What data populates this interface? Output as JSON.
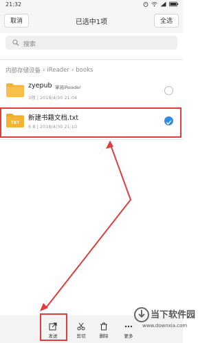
{
  "status_bar": {
    "time": "21:32"
  },
  "header": {
    "cancel_label": "取消",
    "title": "已选中1项",
    "select_all_label": "全选"
  },
  "search": {
    "placeholder": "搜索"
  },
  "breadcrumb": {
    "items": [
      "内部存储设备",
      "iReader",
      "books"
    ]
  },
  "files": [
    {
      "name": "zyepub",
      "source": "掌阅iReader",
      "meta": "3项 | 2018/4/30 21:04",
      "type": "folder",
      "selected": false
    },
    {
      "name": "新建书籍文档.txt",
      "meta": "6 B | 2018/4/30 21:10",
      "type": "txt",
      "icon_text": "TXT",
      "selected": true
    }
  ],
  "toolbar": {
    "send_label": "发送",
    "cut_label": "剪切",
    "delete_label": "删除",
    "more_label": "更多"
  },
  "watermark": {
    "title": "当下软件园",
    "url": "www.downxia.com"
  },
  "colors": {
    "accent": "#2e8ee6",
    "highlight": "#e03c3c",
    "folder": "#f5b335"
  }
}
